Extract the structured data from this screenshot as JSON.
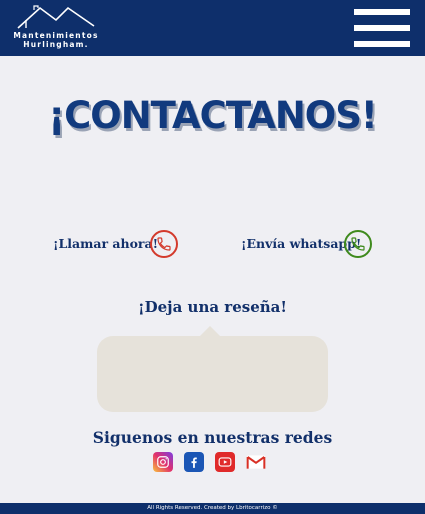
{
  "header": {
    "logo_line1": "Mantenimientos",
    "logo_line2": "Hurlingham.",
    "menu_icon": "hamburger-menu-icon"
  },
  "main": {
    "title": "¡CONTACTANOS!",
    "call_label": "¡Llamar ahora!",
    "whatsapp_label": "¡Envía whatsapp!",
    "review_title": "¡Deja una reseña!",
    "social_title": "Siguenos en nuestras redes"
  },
  "social_icons": [
    "instagram-icon",
    "facebook-icon",
    "youtube-icon",
    "gmail-icon"
  ],
  "footer": {
    "text": "All Rights Reserved. Created by Lbritocarrizo ©"
  },
  "colors": {
    "header_bg": "#0e2f6b",
    "title": "#113a7e",
    "call_accent": "#d33a2c",
    "whatsapp_accent": "#3f8a1d",
    "review_box": "#e6e2da"
  }
}
